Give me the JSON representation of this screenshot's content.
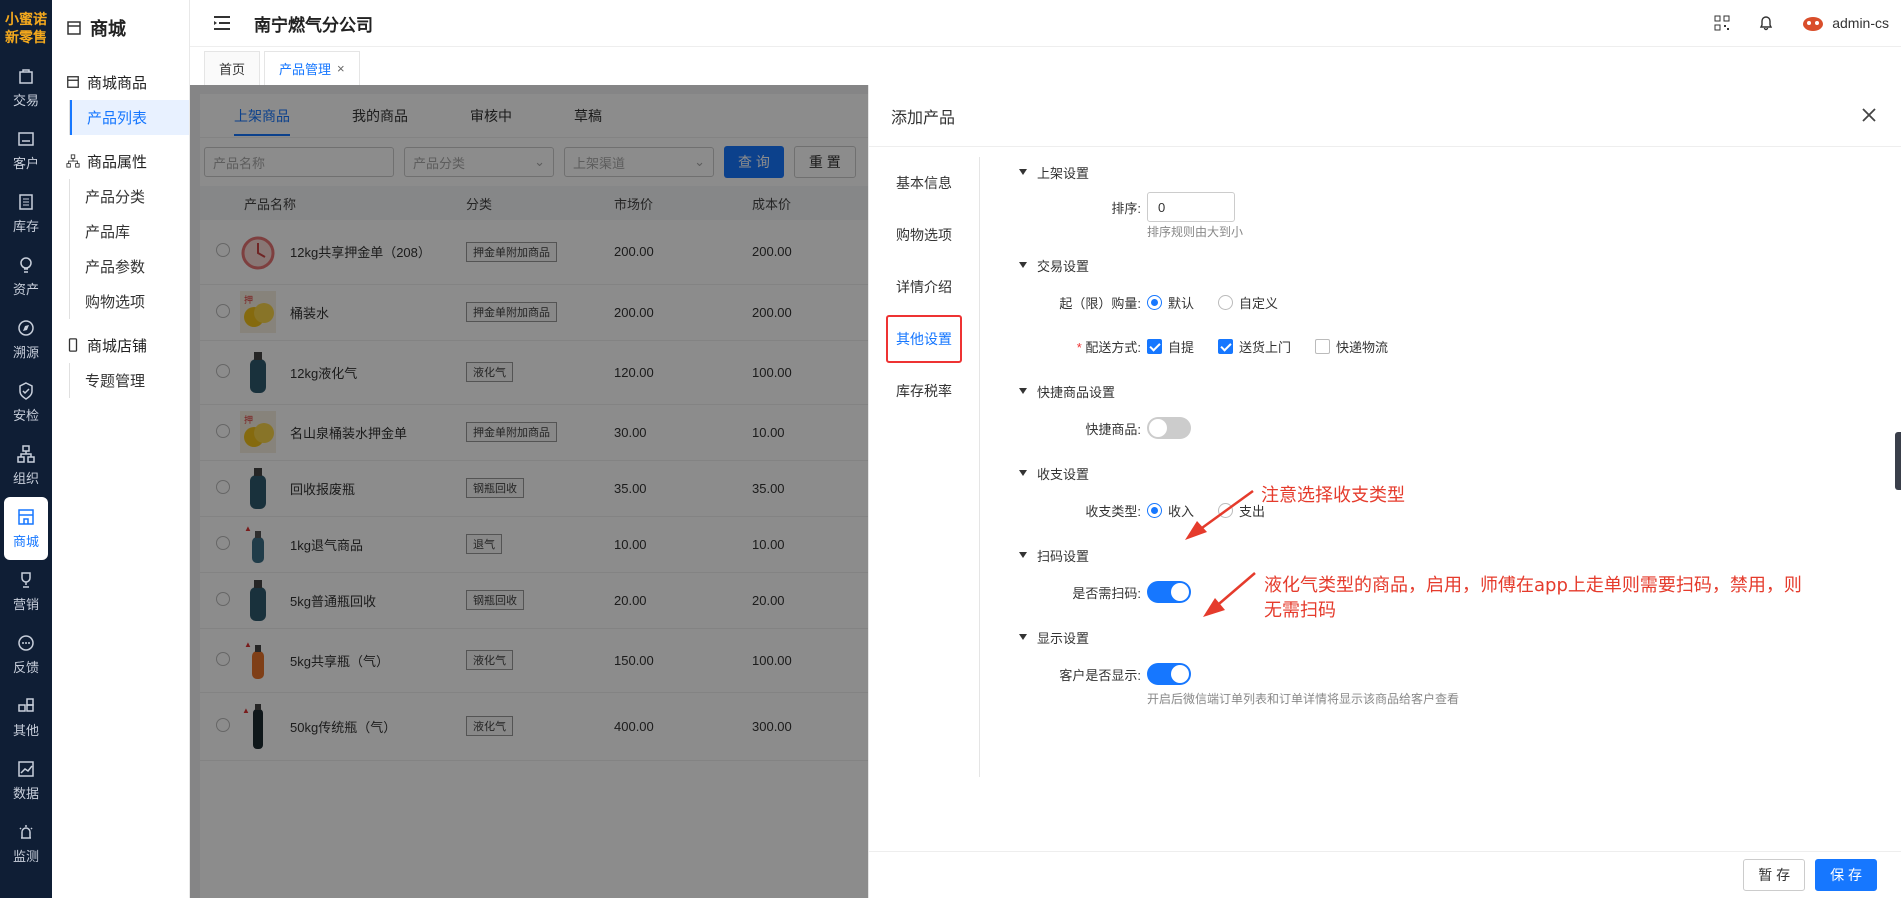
{
  "logo": {
    "line1": "小蜜诺",
    "line2": "新零售"
  },
  "rail": [
    {
      "label": "交易",
      "icon": "bag-icon"
    },
    {
      "label": "客户",
      "icon": "id-card-icon"
    },
    {
      "label": "库存",
      "icon": "list-box-icon"
    },
    {
      "label": "资产",
      "icon": "bulb-icon"
    },
    {
      "label": "溯源",
      "icon": "compass-icon"
    },
    {
      "label": "安检",
      "icon": "shield-check-icon"
    },
    {
      "label": "组织",
      "icon": "org-chart-icon"
    },
    {
      "label": "商城",
      "icon": "store-icon",
      "active": true
    },
    {
      "label": "营销",
      "icon": "trophy-icon"
    },
    {
      "label": "反馈",
      "icon": "chat-bubble-icon"
    },
    {
      "label": "其他",
      "icon": "apps-icon"
    },
    {
      "label": "数据",
      "icon": "chart-icon"
    },
    {
      "label": "监测",
      "icon": "alarm-icon"
    }
  ],
  "sidebar": {
    "title": "商城",
    "groups": [
      {
        "label": "商城商品",
        "items": [
          "产品列表"
        ]
      },
      {
        "label": "商品属性",
        "items": [
          "产品分类",
          "产品库",
          "产品参数",
          "购物选项"
        ]
      },
      {
        "label": "商城店铺",
        "items": [
          "专题管理"
        ]
      }
    ],
    "active_item": "产品列表"
  },
  "header": {
    "company": "南宁燃气分公司",
    "user": "admin-cs"
  },
  "tabs": [
    {
      "label": "首页"
    },
    {
      "label": "产品管理",
      "active": true
    }
  ],
  "list": {
    "subtabs": [
      "上架商品",
      "我的商品",
      "审核中",
      "草稿"
    ],
    "filters": {
      "name_placeholder": "产品名称",
      "category_placeholder": "产品分类",
      "channel_placeholder": "上架渠道",
      "query": "查 询",
      "reset": "重 置"
    },
    "columns": [
      "产品名称",
      "分类",
      "市场价",
      "成本价"
    ],
    "rows": [
      {
        "name": "12kg共享押金单（208）",
        "category": "押金单附加商品",
        "market": "200.00",
        "cost": "200.00",
        "thumb": "clock"
      },
      {
        "name": "桶装水",
        "category": "押金单附加商品",
        "market": "200.00",
        "cost": "200.00",
        "thumb": "coins"
      },
      {
        "name": "12kg液化气",
        "category": "液化气",
        "market": "120.00",
        "cost": "100.00",
        "thumb": "cylinder"
      },
      {
        "name": "名山泉桶装水押金单",
        "category": "押金单附加商品",
        "market": "30.00",
        "cost": "10.00",
        "thumb": "coins"
      },
      {
        "name": "回收报废瓶",
        "category": "钢瓶回收",
        "market": "35.00",
        "cost": "35.00",
        "thumb": "cylinder"
      },
      {
        "name": "1kg退气商品",
        "category": "退气",
        "market": "10.00",
        "cost": "10.00",
        "thumb": "small-cylinder"
      },
      {
        "name": "5kg普通瓶回收",
        "category": "钢瓶回收",
        "market": "20.00",
        "cost": "20.00",
        "thumb": "cylinder"
      },
      {
        "name": "5kg共享瓶（气）",
        "category": "液化气",
        "market": "150.00",
        "cost": "100.00",
        "thumb": "orange-cylinder"
      },
      {
        "name": "50kg传统瓶（气）",
        "category": "液化气",
        "market": "400.00",
        "cost": "300.00",
        "thumb": "tall-cylinder"
      }
    ]
  },
  "drawer": {
    "title": "添加产品",
    "nav": [
      "基本信息",
      "购物选项",
      "详情介绍",
      "其他设置",
      "库存税率"
    ],
    "nav_active": "其他设置",
    "sections": {
      "listing": {
        "title": "上架设置",
        "sort_label": "排序:",
        "sort_value": "0",
        "sort_hint": "排序规则由大到小"
      },
      "trade": {
        "title": "交易设置",
        "limit_label": "起（限）购量:",
        "limit_options": [
          "默认",
          "自定义"
        ],
        "limit_selected": "默认",
        "delivery_label": "配送方式:",
        "delivery_required": "*",
        "delivery_options": [
          {
            "label": "自提",
            "checked": true
          },
          {
            "label": "送货上门",
            "checked": true
          },
          {
            "label": "快递物流",
            "checked": false
          }
        ]
      },
      "quick": {
        "title": "快捷商品设置",
        "label": "快捷商品:",
        "enabled": false
      },
      "finance": {
        "title": "收支设置",
        "label": "收支类型:",
        "options": [
          "收入",
          "支出"
        ],
        "selected": "收入"
      },
      "scan": {
        "title": "扫码设置",
        "label": "是否需扫码:",
        "enabled": true
      },
      "display": {
        "title": "显示设置",
        "label": "客户是否显示:",
        "enabled": true,
        "hint": "开启后微信端订单列表和订单详情将显示该商品给客户查看"
      }
    },
    "annotations": {
      "finance_note": "注意选择收支类型",
      "scan_note_line1": "液化气类型的商品，启用，师傅在app上走单则需要扫码，禁用，则",
      "scan_note_line2": "无需扫码"
    },
    "footer": {
      "draft": "暂 存",
      "save": "保 存"
    }
  },
  "colors": {
    "accent": "#1677ff",
    "annotation": "#e53b2c",
    "rail_bg": "#0f1e35"
  }
}
